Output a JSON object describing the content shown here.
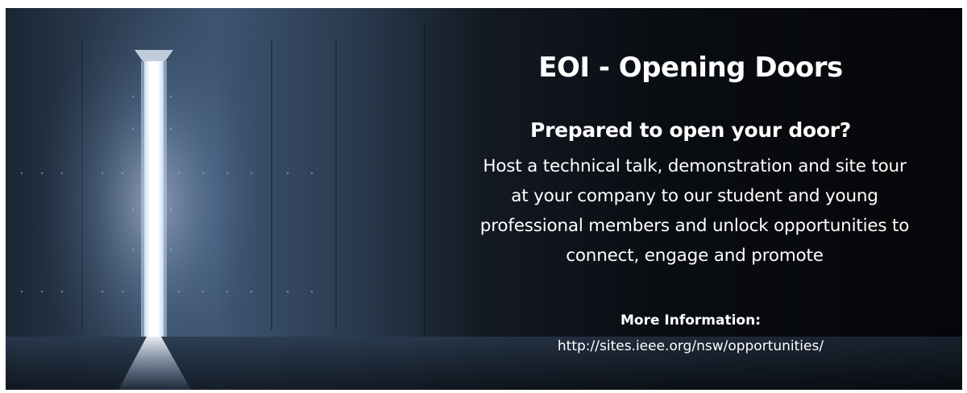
{
  "banner": {
    "title": "EOI - Opening Doors",
    "subtitle": "Prepared to open your door?",
    "body_lines": [
      "Host a technical talk, demonstration and site tour",
      "at your company to our student and young",
      "professional members and unlock opportunities to",
      "connect, engage and promote"
    ],
    "more_label": "More Information:",
    "more_link": "http://sites.ieee.org/nsw/opportunities/",
    "image_description_icon": "light-through-door-icon"
  },
  "colors": {
    "text": "#ffffff",
    "background_dark": "#0a0d12",
    "wall_blue": "#3a4f6a",
    "light_glow": "#e8f1ff"
  }
}
